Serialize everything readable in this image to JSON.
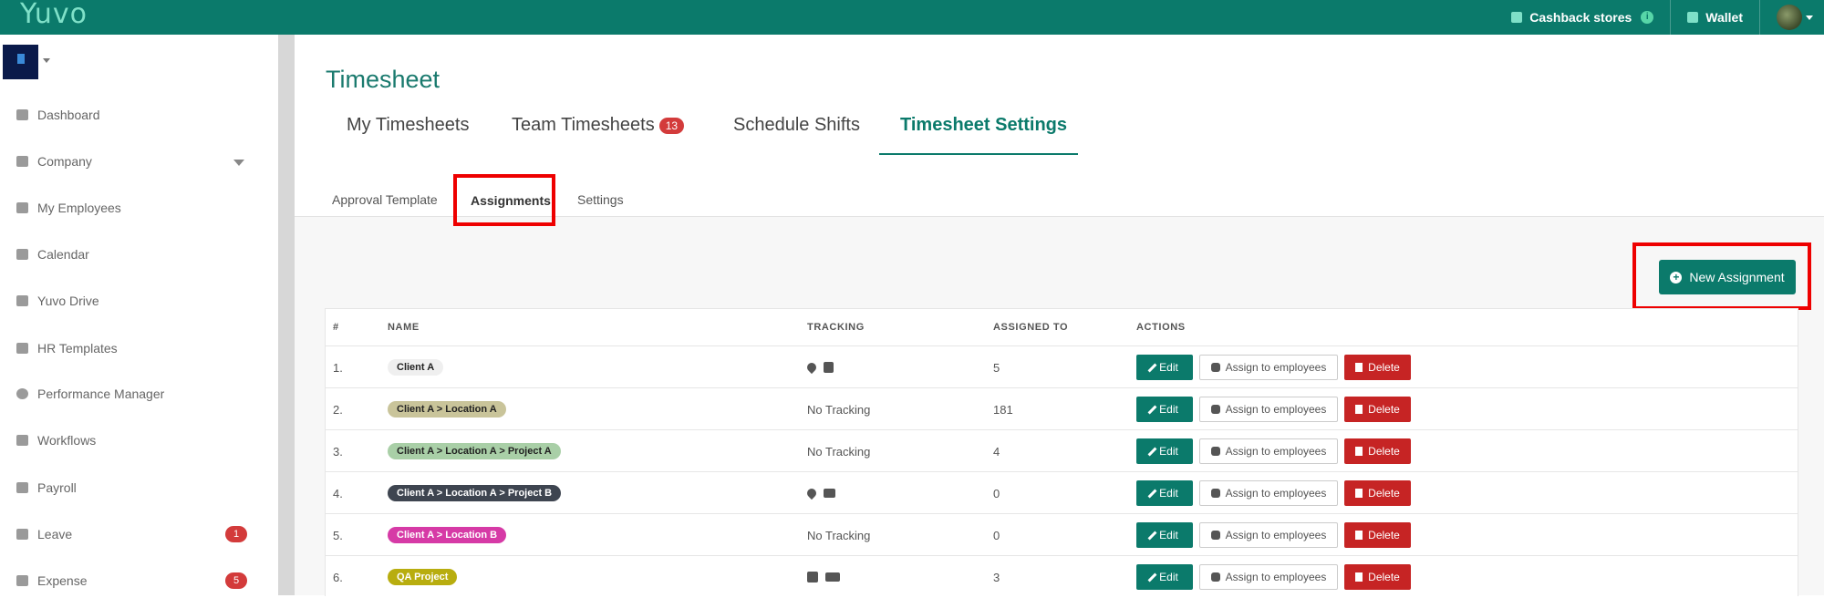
{
  "app": {
    "logo": "Yuvo"
  },
  "topbar": {
    "cashback_label": "Cashback stores",
    "info_icon": "i",
    "wallet_label": "Wallet"
  },
  "sidebar": {
    "items": [
      {
        "label": "Dashboard",
        "icon": "dashboard-icon"
      },
      {
        "label": "Company",
        "icon": "building-icon"
      },
      {
        "label": "My Employees",
        "icon": "users-icon"
      },
      {
        "label": "Calendar",
        "icon": "calendar-icon"
      },
      {
        "label": "Yuvo Drive",
        "icon": "folder-icon"
      },
      {
        "label": "HR Templates",
        "icon": "edit-icon"
      },
      {
        "label": "Performance Manager",
        "icon": "target-icon"
      },
      {
        "label": "Workflows",
        "icon": "cogs-icon"
      },
      {
        "label": "Payroll",
        "icon": "money-icon"
      },
      {
        "label": "Leave",
        "icon": "calendar-check-icon",
        "badge": "1"
      },
      {
        "label": "Expense",
        "icon": "hand-coin-icon",
        "badge": "5"
      }
    ]
  },
  "page": {
    "title": "Timesheet",
    "tabs": [
      {
        "label": "My Timesheets"
      },
      {
        "label": "Team Timesheets",
        "badge": "13"
      },
      {
        "label": "Schedule Shifts"
      },
      {
        "label": "Timesheet Settings"
      }
    ],
    "subtabs": [
      {
        "label": "Approval Template"
      },
      {
        "label": "Assignments"
      },
      {
        "label": "Settings"
      }
    ],
    "new_button": "New Assignment",
    "new_button_icon": "+"
  },
  "table": {
    "headers": [
      "#",
      "NAME",
      "TRACKING",
      "ASSIGNED TO",
      "ACTIONS"
    ],
    "rows": [
      {
        "num": "1.",
        "name": "Client A",
        "tracking": "",
        "assigned": "5",
        "pill_bg": "#efefef",
        "pill_fg": "#222"
      },
      {
        "num": "2.",
        "name": "Client A > Location A",
        "tracking": "No Tracking",
        "assigned": "181",
        "pill_bg": "#c9c49a",
        "pill_fg": "#222"
      },
      {
        "num": "3.",
        "name": "Client A > Location A > Project A",
        "tracking": "No Tracking",
        "assigned": "4",
        "pill_bg": "#a9cfa7",
        "pill_fg": "#222"
      },
      {
        "num": "4.",
        "name": "Client A > Location A > Project B",
        "tracking": "",
        "assigned": "0",
        "pill_bg": "#3e4550",
        "pill_fg": "#ffffff"
      },
      {
        "num": "5.",
        "name": "Client A > Location B",
        "tracking": "No Tracking",
        "assigned": "0",
        "pill_bg": "#d63aa6",
        "pill_fg": "#ffffff"
      },
      {
        "num": "6.",
        "name": "QA Project",
        "tracking": "",
        "assigned": "3",
        "pill_bg": "#b8ad0f",
        "pill_fg": "#ffffff"
      }
    ],
    "actions": {
      "edit": "Edit",
      "assign": "Assign to employees",
      "delete": "Delete"
    }
  }
}
